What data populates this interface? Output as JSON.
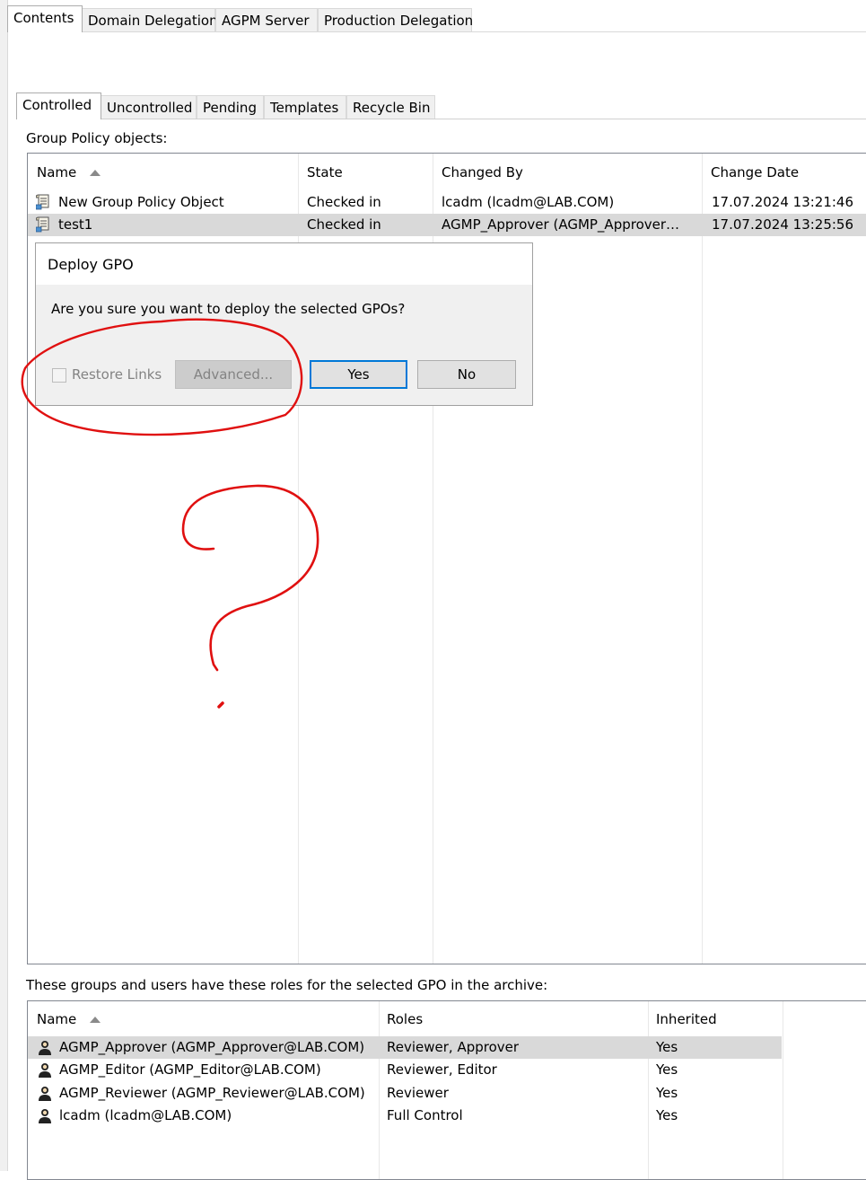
{
  "top_tabs": [
    "Contents",
    "Domain Delegation",
    "AGPM Server",
    "Production Delegation"
  ],
  "sub_tabs": [
    "Controlled",
    "Uncontrolled",
    "Pending",
    "Templates",
    "Recycle Bin"
  ],
  "gpo_section_label": "Group Policy objects:",
  "gpo_table": {
    "headers": [
      "Name",
      "State",
      "Changed By",
      "Change Date"
    ],
    "rows": [
      {
        "name": "New Group Policy Object",
        "state": "Checked in",
        "changed_by": "lcadm (lcadm@LAB.COM)",
        "change_date": "17.07.2024 13:21:46",
        "selected": false
      },
      {
        "name": "test1",
        "state": "Checked in",
        "changed_by": "AGMP_Approver (AGMP_Approver…",
        "change_date": "17.07.2024 13:25:56",
        "selected": true
      }
    ]
  },
  "dialog": {
    "title": "Deploy GPO",
    "message": "Are you sure you want to deploy the selected GPOs?",
    "restore_links_label": "Restore Links",
    "restore_links_checked": false,
    "advanced_label": "Advanced...",
    "yes_label": "Yes",
    "no_label": "No"
  },
  "roles_section_label": "These groups and users have these roles for the selected GPO in the archive:",
  "roles_table": {
    "headers": [
      "Name",
      "Roles",
      "Inherited"
    ],
    "rows": [
      {
        "name": "AGMP_Approver (AGMP_Approver@LAB.COM)",
        "roles": "Reviewer, Approver",
        "inherited": "Yes",
        "selected": true
      },
      {
        "name": "AGMP_Editor (AGMP_Editor@LAB.COM)",
        "roles": "Reviewer, Editor",
        "inherited": "Yes",
        "selected": false
      },
      {
        "name": "AGMP_Reviewer (AGMP_Reviewer@LAB.COM)",
        "roles": "Reviewer",
        "inherited": "Yes",
        "selected": false
      },
      {
        "name": "lcadm (lcadm@LAB.COM)",
        "roles": "Full Control",
        "inherited": "Yes",
        "selected": false
      }
    ]
  },
  "colors": {
    "annotation": "#e01010",
    "selection": "#d9d9d9",
    "dialog_bg": "#f0f0f0",
    "default_button_border": "#0078d7"
  },
  "icons": {
    "gpo_row": "gpo-scroll-icon",
    "user_row": "group-user-icon",
    "sort": "sort-ascending-icon"
  }
}
